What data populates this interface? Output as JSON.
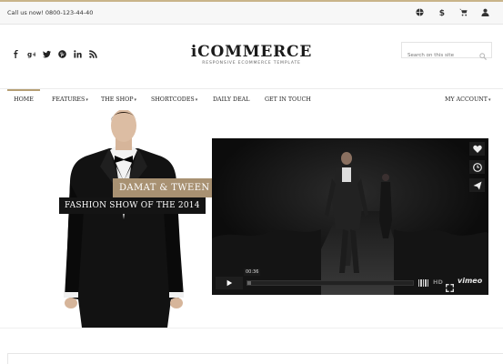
{
  "topbar": {
    "phone": "Call us now! 0800-123-44-40",
    "tools": [
      {
        "name": "globe-icon"
      },
      {
        "name": "dollar-icon"
      },
      {
        "name": "cart-icon"
      },
      {
        "name": "user-icon"
      }
    ]
  },
  "header": {
    "social": [
      "facebook-icon",
      "google-plus-icon",
      "twitter-icon",
      "pinterest-icon",
      "linkedin-icon",
      "rss-icon"
    ],
    "logo_name": "iCOMMERCE",
    "logo_tagline": "RESPONSIVE ECOMMERCE TEMPLATE",
    "search_placeholder": "Search on this site"
  },
  "nav": {
    "home": "HOME",
    "features": "FEATURES",
    "shop": "THE SHOP",
    "shortcodes": "SHORTCODES",
    "daily_deal": "DAILY DEAL",
    "contact": "GET IN TOUCH",
    "account": "MY ACCOUNT",
    "active": "HOME"
  },
  "hero": {
    "overlay_title": "DAMAT & TWEEN",
    "overlay_subtitle": "FASHION SHOW OF THE 2014",
    "video": {
      "time": "00:36",
      "hd_label": "HD",
      "brand": "vimeo",
      "progress": 0.02,
      "side_icons": [
        "heart-icon",
        "clock-icon",
        "send-icon"
      ]
    }
  },
  "colors": {
    "accent": "#b69f74",
    "overlay_tan": "#a89172",
    "overlay_dark": "#141414"
  }
}
